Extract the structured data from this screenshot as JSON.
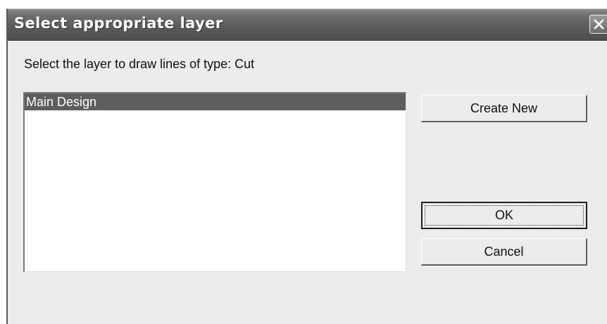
{
  "dialog": {
    "title": "Select appropriate layer",
    "prompt": "Select the layer to draw lines of type: Cut"
  },
  "layers": {
    "items": [
      {
        "label": "Main Design",
        "selected": true
      }
    ]
  },
  "buttons": {
    "create_new": "Create New",
    "ok": "OK",
    "cancel": "Cancel"
  },
  "icons": {
    "close": "close-icon"
  },
  "colors": {
    "titlebar": "#5a5a5a",
    "selection": "#5e5e5e",
    "dialog_bg": "#ececec"
  }
}
